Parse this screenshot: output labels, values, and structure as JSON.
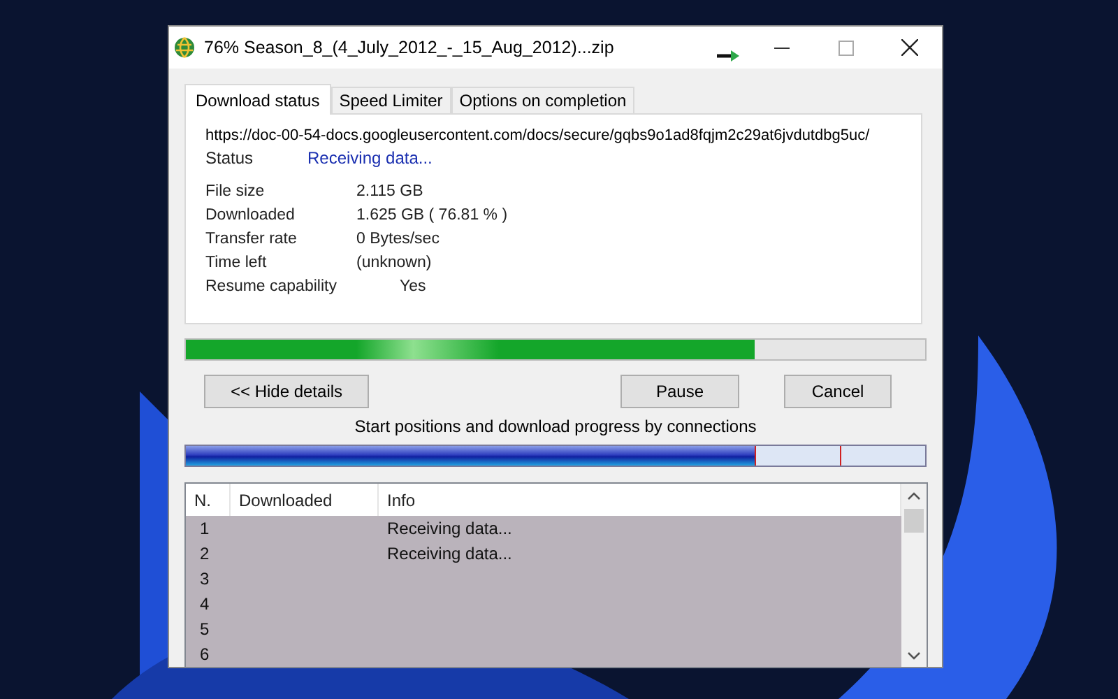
{
  "window": {
    "title": "76% Season_8_(4_July_2012_-_15_Aug_2012)...zip"
  },
  "tabs": [
    {
      "label": "Download status",
      "selected": true
    },
    {
      "label": "Speed Limiter",
      "selected": false
    },
    {
      "label": "Options on completion",
      "selected": false
    }
  ],
  "url": "https://doc-00-54-docs.googleusercontent.com/docs/secure/gqbs9o1ad8fqjm2c29at6jvdutdbg5uc/",
  "status": {
    "label": "Status",
    "value": "Receiving data..."
  },
  "details": [
    {
      "label": "File size",
      "value": "2.115  GB"
    },
    {
      "label": "Downloaded",
      "value": "1.625  GB  ( 76.81 % )"
    },
    {
      "label": "Transfer rate",
      "value": "0  Bytes/sec"
    },
    {
      "label": "Time left",
      "value": "(unknown)"
    },
    {
      "label": "Resume capability",
      "value": "Yes",
      "indented": true
    }
  ],
  "progress": {
    "level": 0.77
  },
  "buttons": [
    "<< Hide details",
    "Pause",
    "Cancel"
  ],
  "connections": {
    "caption": "Start positions and download progress by connections",
    "level": 0.77
  },
  "table": {
    "columns": [
      "N.",
      "Downloaded",
      "Info"
    ],
    "rows": [
      {
        "n": "1",
        "downloaded": "",
        "info": "Receiving data..."
      },
      {
        "n": "2",
        "downloaded": "",
        "info": "Receiving data..."
      },
      {
        "n": "3",
        "downloaded": "",
        "info": ""
      },
      {
        "n": "4",
        "downloaded": "",
        "info": ""
      },
      {
        "n": "5",
        "downloaded": "",
        "info": ""
      },
      {
        "n": "6",
        "downloaded": "",
        "info": ""
      }
    ]
  }
}
